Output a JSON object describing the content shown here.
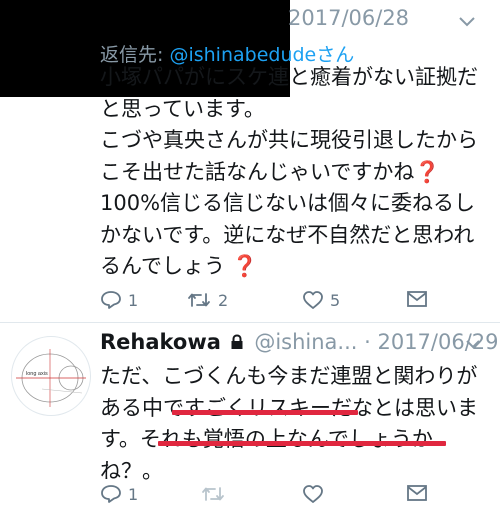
{
  "tweet1": {
    "timestamp": "2017/06/28",
    "reply_prefix": "返信先: ",
    "reply_handle": "@ishinabedudeさん",
    "lines": [
      "小塚パパがにスケ連と癒着がない証拠だ",
      "と思っています。",
      "こづや真央さんが共に現役引退したから",
      "こそ出せた話なんじゃいですかね",
      "100%信じる信じないは個々に委ねるし",
      "かないです。逆になぜ不自然だと思われ",
      "るんでしょう "
    ],
    "question_mark": "❓",
    "counts": {
      "reply": "1",
      "retweet": "2",
      "like": "5"
    }
  },
  "tweet2": {
    "name": "Rehakowa",
    "handle": "@ishina...",
    "timestamp": "· 2017/06/29",
    "avatar_label": "long axis",
    "lines": [
      "ただ、こづくんも今まだ連盟と関わりが",
      "ある中ですごくリスキーだなとは思いま",
      "す。それも覚悟の上なんでしょうか",
      "ね？。"
    ],
    "counts": {
      "reply": "1"
    }
  },
  "colors": {
    "accent": "#1da1f2",
    "muted": "#8899a6",
    "icon": "#657786",
    "underline": "#e0273f",
    "question": "#e0245e"
  }
}
